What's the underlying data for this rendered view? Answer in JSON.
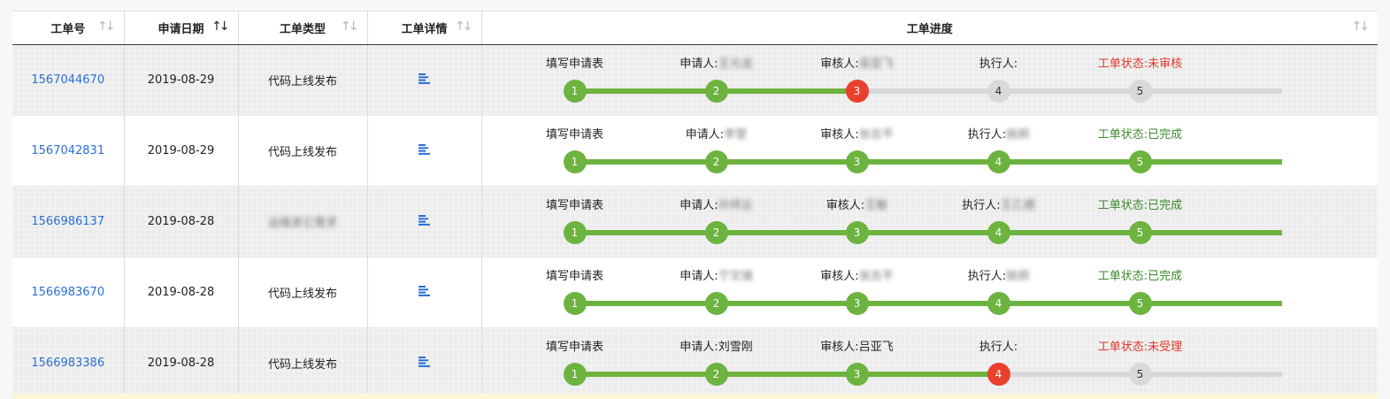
{
  "headers": [
    {
      "label": "工单号",
      "sort": "none"
    },
    {
      "label": "申请日期",
      "sort": "active"
    },
    {
      "label": "工单类型",
      "sort": "none"
    },
    {
      "label": "工单详情",
      "sort": "none"
    },
    {
      "label": "工单进度",
      "sort": "none"
    }
  ],
  "sort_glyph": "↑↓",
  "colors": {
    "done": "#6db33f",
    "current": "#e8402c",
    "pending": "#d9d9d9",
    "link": "#2a6fd6"
  },
  "rows": [
    {
      "id": "1567044670",
      "date": "2019-08-29",
      "type": "代码上线发布",
      "type_blurred": false,
      "steps": [
        {
          "prefix": "填写申请表",
          "name": ""
        },
        {
          "prefix": "申请人:",
          "name": "王元龙",
          "blurred": true
        },
        {
          "prefix": "审核人:",
          "name": "吴亚飞",
          "blurred": true
        },
        {
          "prefix": "执行人:",
          "name": ""
        },
        {
          "prefix": "工单状态:未审核",
          "name": "",
          "tone": "red"
        }
      ],
      "progress_step": 3,
      "states": [
        "done",
        "done",
        "current",
        "pending",
        "pending"
      ]
    },
    {
      "id": "1567042831",
      "date": "2019-08-29",
      "type": "代码上线发布",
      "type_blurred": false,
      "steps": [
        {
          "prefix": "填写申请表",
          "name": ""
        },
        {
          "prefix": "申请人:",
          "name": "李慧",
          "blurred": true
        },
        {
          "prefix": "审核人:",
          "name": "张吉平",
          "blurred": true
        },
        {
          "prefix": "执行人:",
          "name": "姚炯",
          "blurred": true
        },
        {
          "prefix": "工单状态:已完成",
          "name": "",
          "tone": "green"
        }
      ],
      "progress_step": 5,
      "states": [
        "done",
        "done",
        "done",
        "done",
        "done"
      ]
    },
    {
      "id": "1566986137",
      "date": "2019-08-28",
      "type": "运维其它需求",
      "type_blurred": true,
      "steps": [
        {
          "prefix": "填写申请表",
          "name": ""
        },
        {
          "prefix": "申请人:",
          "name": "孙祥云",
          "blurred": true
        },
        {
          "prefix": "审核人:",
          "name": "王敏",
          "blurred": true
        },
        {
          "prefix": "执行人:",
          "name": "王乙德",
          "blurred": true
        },
        {
          "prefix": "工单状态:已完成",
          "name": "",
          "tone": "green"
        }
      ],
      "progress_step": 5,
      "states": [
        "done",
        "done",
        "done",
        "done",
        "done"
      ]
    },
    {
      "id": "1566983670",
      "date": "2019-08-28",
      "type": "代码上线发布",
      "type_blurred": false,
      "steps": [
        {
          "prefix": "填写申请表",
          "name": ""
        },
        {
          "prefix": "申请人:",
          "name": "宁文瑞",
          "blurred": true
        },
        {
          "prefix": "审核人:",
          "name": "张吉平",
          "blurred": true
        },
        {
          "prefix": "执行人:",
          "name": "姚炯",
          "blurred": true
        },
        {
          "prefix": "工单状态:已完成",
          "name": "",
          "tone": "green"
        }
      ],
      "progress_step": 5,
      "states": [
        "done",
        "done",
        "done",
        "done",
        "done"
      ]
    },
    {
      "id": "1566983386",
      "date": "2019-08-28",
      "type": "代码上线发布",
      "type_blurred": false,
      "steps": [
        {
          "prefix": "填写申请表",
          "name": ""
        },
        {
          "prefix": "申请人:",
          "name": "刘雪刚",
          "blurred": false
        },
        {
          "prefix": "审核人:",
          "name": "吕亚飞",
          "blurred": false
        },
        {
          "prefix": "执行人:",
          "name": ""
        },
        {
          "prefix": "工单状态:未受理",
          "name": "",
          "tone": "red"
        }
      ],
      "progress_step": 4,
      "states": [
        "done",
        "done",
        "done",
        "current",
        "pending"
      ]
    }
  ]
}
